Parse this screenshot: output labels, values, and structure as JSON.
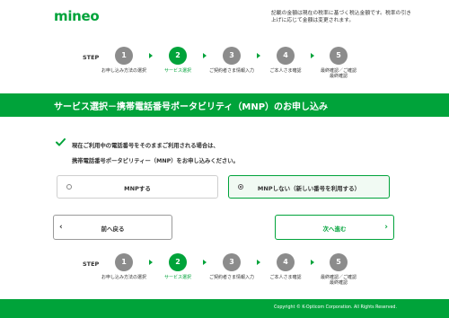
{
  "header": {
    "logo": "mineo",
    "tax_note": "記載の金額は現在の税率に基づく税込金額です。税率の引き上げに応じて金額は変更されます。"
  },
  "stepper": {
    "label": "STEP",
    "steps": [
      {
        "number": "1",
        "label": "お申し込み方法の選択",
        "active": false
      },
      {
        "number": "2",
        "label": "サービス選択",
        "active": true
      },
      {
        "number": "3",
        "label": "ご契約者さま情報入力",
        "active": false
      },
      {
        "number": "4",
        "label": "ご本人さま確認",
        "active": false
      },
      {
        "number": "5",
        "label": "最終確認お申し込み",
        "active": false
      }
    ],
    "step5_line1": "最終確認／ご確認",
    "step5_line2": "最終確認"
  },
  "banner": {
    "title": "サービス選択－携帯電話番号ポータビリティ（MNP）のお申し込み"
  },
  "notice": {
    "line1": "現在ご利用中の電話番号をそのままご利用される場合は、",
    "line2": "携帯電話番号ポータビリティー（MNP）をお申し込みください。"
  },
  "options": {
    "mnp_yes": "MNPする",
    "mnp_no": "MNPしない（新しい番号を利用する）",
    "selected": "mnp_no"
  },
  "buttons": {
    "back": "前へ戻る",
    "next": "次へ進む"
  },
  "footer": {
    "copyright": "Copyright © K-Opticom Corporation. All Rights Reserved."
  },
  "colors": {
    "brand": "#00a33a",
    "inactive_step": "#8c8c8c"
  }
}
